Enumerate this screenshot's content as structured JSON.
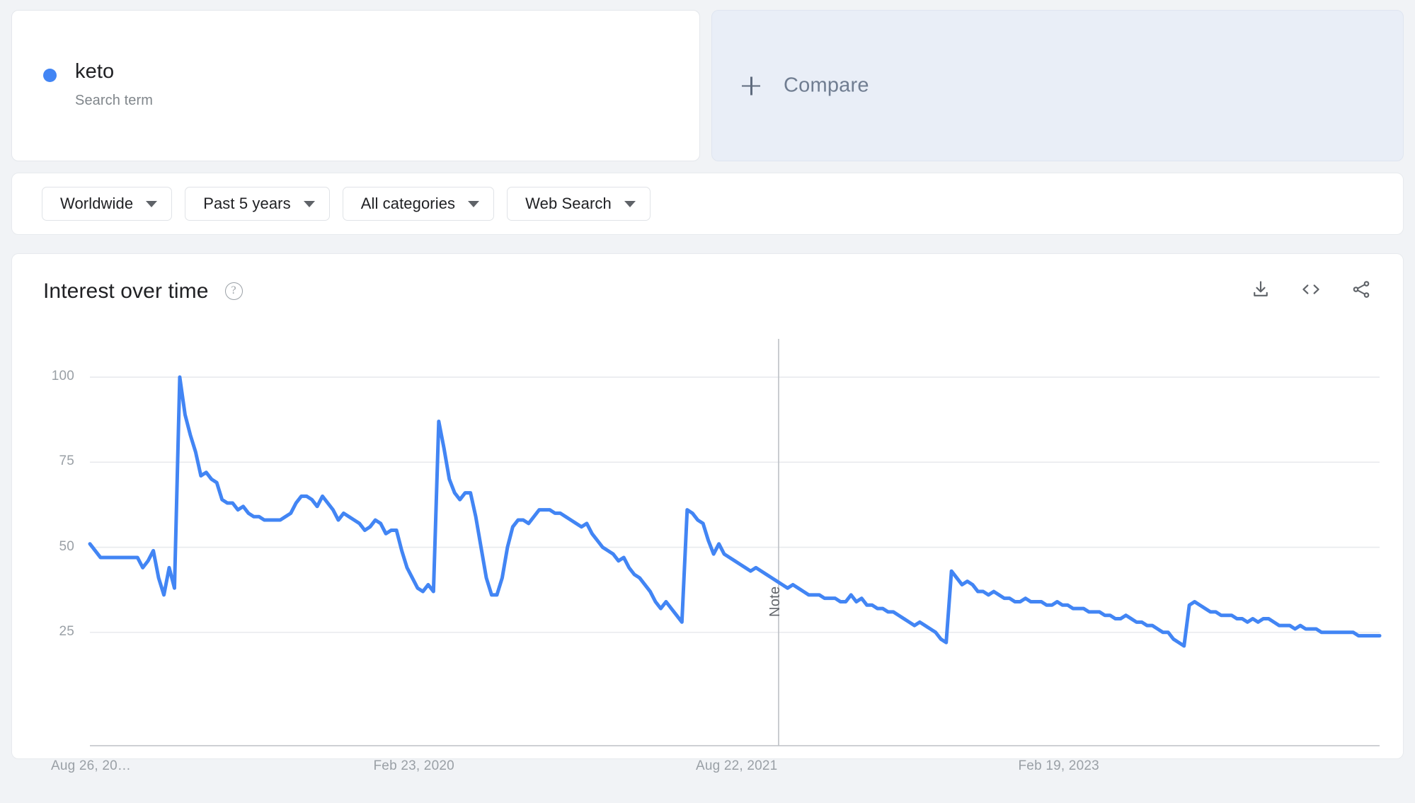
{
  "term_card": {
    "term": "keto",
    "subtitle": "Search term",
    "dot_color": "#4285f4"
  },
  "compare_card": {
    "label": "Compare",
    "plus_icon": "plus-icon"
  },
  "filters": [
    {
      "label": "Worldwide",
      "icon": "chevron-down-icon"
    },
    {
      "label": "Past 5 years",
      "icon": "chevron-down-icon"
    },
    {
      "label": "All categories",
      "icon": "chevron-down-icon"
    },
    {
      "label": "Web Search",
      "icon": "chevron-down-icon"
    }
  ],
  "chart_card": {
    "title": "Interest over time",
    "help_icon": "help-circle-icon",
    "actions": [
      {
        "name": "download-icon",
        "title": "Download"
      },
      {
        "name": "embed-code-icon",
        "title": "Embed"
      },
      {
        "name": "share-icon",
        "title": "Share"
      }
    ]
  },
  "chart_data": {
    "type": "line",
    "title": "Interest over time",
    "xlabel": "",
    "ylabel": "",
    "ylim": [
      0,
      105
    ],
    "yticks": [
      25,
      50,
      75,
      100
    ],
    "ytick_labels": [
      "25",
      "50",
      "75",
      "100"
    ],
    "xtick_labels": [
      "Aug 26, 20…",
      "Feb 23, 2020",
      "Aug 22, 2021",
      "Feb 19, 2023"
    ],
    "xtick_positions_pct": [
      0.0,
      25.0,
      50.0,
      75.0
    ],
    "grid": true,
    "legend": false,
    "line_color": "#4285f4",
    "line_width": 5,
    "annotations": [
      {
        "label": "Note",
        "x_pct": 53.4,
        "orientation": "vertical",
        "color": "#5f6368"
      }
    ],
    "series": [
      {
        "name": "keto",
        "color": "#4285f4",
        "values": [
          51,
          49,
          47,
          47,
          47,
          47,
          47,
          47,
          47,
          47,
          44,
          46,
          49,
          41,
          36,
          44,
          38,
          100,
          89,
          83,
          78,
          71,
          72,
          70,
          69,
          64,
          63,
          63,
          61,
          62,
          60,
          59,
          59,
          58,
          58,
          58,
          58,
          59,
          60,
          63,
          65,
          65,
          64,
          62,
          65,
          63,
          61,
          58,
          60,
          59,
          58,
          57,
          55,
          56,
          58,
          57,
          54,
          55,
          55,
          49,
          44,
          41,
          38,
          37,
          39,
          37,
          87,
          79,
          70,
          66,
          64,
          66,
          66,
          59,
          50,
          41,
          36,
          36,
          41,
          50,
          56,
          58,
          58,
          57,
          59,
          61,
          61,
          61,
          60,
          60,
          59,
          58,
          57,
          56,
          57,
          54,
          52,
          50,
          49,
          48,
          46,
          47,
          44,
          42,
          41,
          39,
          37,
          34,
          32,
          34,
          32,
          30,
          28,
          61,
          60,
          58,
          57,
          52,
          48,
          51,
          48,
          47,
          46,
          45,
          44,
          43,
          44,
          43,
          42,
          41,
          40,
          39,
          38,
          39,
          38,
          37,
          36,
          36,
          36,
          35,
          35,
          35,
          34,
          34,
          36,
          34,
          35,
          33,
          33,
          32,
          32,
          31,
          31,
          30,
          29,
          28,
          27,
          28,
          27,
          26,
          25,
          23,
          22,
          43,
          41,
          39,
          40,
          39,
          37,
          37,
          36,
          37,
          36,
          35,
          35,
          34,
          34,
          35,
          34,
          34,
          34,
          33,
          33,
          34,
          33,
          33,
          32,
          32,
          32,
          31,
          31,
          31,
          30,
          30,
          29,
          29,
          30,
          29,
          28,
          28,
          27,
          27,
          26,
          25,
          25,
          23,
          22,
          21,
          33,
          34,
          33,
          32,
          31,
          31,
          30,
          30,
          30,
          29,
          29,
          28,
          29,
          28,
          29,
          29,
          28,
          27,
          27,
          27,
          26,
          27,
          26,
          26,
          26,
          25,
          25,
          25,
          25,
          25,
          25,
          25,
          24,
          24,
          24,
          24,
          24
        ]
      }
    ]
  }
}
